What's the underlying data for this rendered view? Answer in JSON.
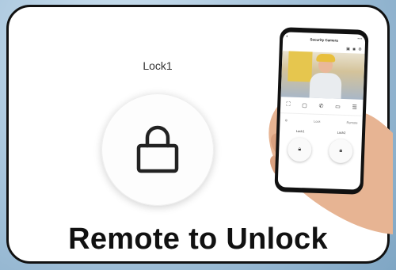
{
  "main": {
    "lock_label": "Lock1",
    "caption": "Remote to Unlock"
  },
  "phone": {
    "title": "Security Camera",
    "back_icon": "‹",
    "more_icon": "⋯",
    "tab_left": "",
    "tab_mid": "Lock",
    "tab_right": "Remote",
    "locks": [
      "Lock1",
      "Lock2"
    ]
  },
  "colors": {
    "background": "#9fbfd7",
    "card_border": "#111111",
    "caption": "#111111"
  }
}
